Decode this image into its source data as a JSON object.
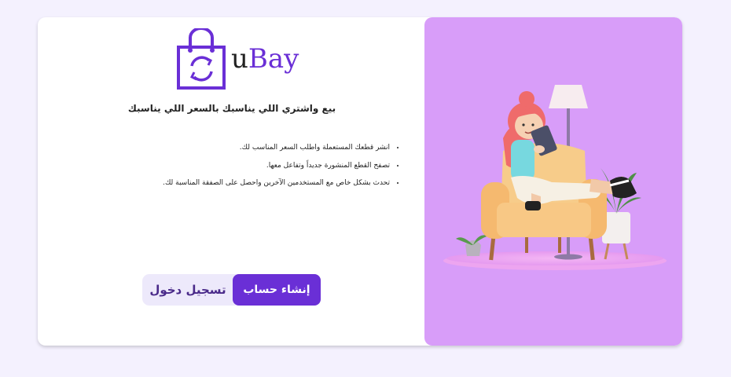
{
  "brand": {
    "name_prefix": "u",
    "name_suffix": "Bay",
    "accent_color": "#6a2fd6",
    "logo_icon": "shopping-bag-recycle-icon"
  },
  "tagline": "بيع واشتري اللي يناسبك بالسعر اللي يناسبك",
  "features": [
    "انشر قطعك المستعملة واطلب السعر المناسب لك.",
    "تصفح القطع المنشورة جديداً وتفاعل معها.",
    "تحدث بشكل خاص مع المستخدمين الآخرين واحصل على الصفقة المناسبة لك."
  ],
  "actions": {
    "signup_label": "إنشاء حساب",
    "login_label": "تسجيل دخول"
  },
  "illustration": {
    "description_icon": "girl-on-armchair-with-tablet-illustration",
    "background_color": "#d89df9"
  }
}
